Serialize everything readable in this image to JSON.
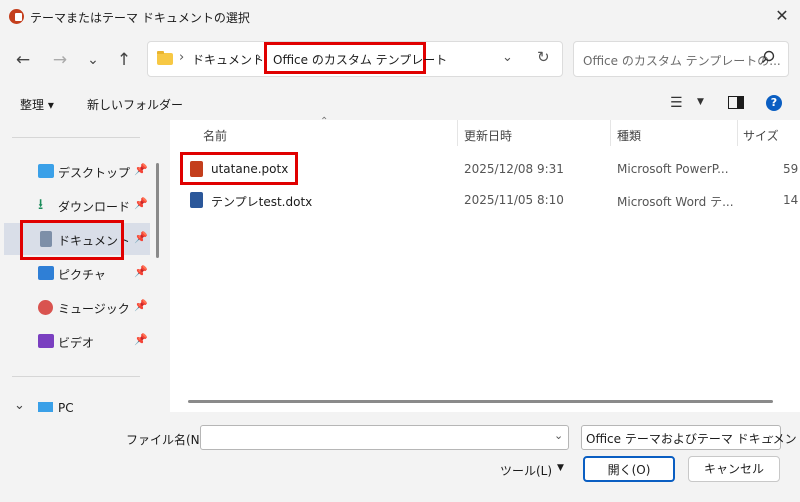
{
  "window": {
    "title": "テーマまたはテーマ ドキュメントの選択",
    "close": "✕"
  },
  "nav": {
    "back": "←",
    "forward": "→",
    "recent": "⌄",
    "up": "↑",
    "breadcrumb": [
      "ドキュメント",
      "Office のカスタム テンプレート"
    ],
    "sep": "›",
    "addr_chevron": "⌄",
    "refresh": "↻",
    "search_placeholder": "Office のカスタム テンプレートの..."
  },
  "toolbar": {
    "organize": "整理 ▾",
    "new_folder": "新しいフォルダー",
    "view_icon": "☰",
    "view_drop": "▼",
    "help": "?"
  },
  "sidebar": {
    "items": [
      {
        "label": "デスクトップ",
        "icon": "desktop-icon",
        "color": "#3aa0e8",
        "pinned": true
      },
      {
        "label": "ダウンロード",
        "icon": "download-icon",
        "color": "#1a8c5a",
        "pinned": true
      },
      {
        "label": "ドキュメント",
        "icon": "documents-icon",
        "color": "#7d8fa8",
        "pinned": true,
        "selected": true
      },
      {
        "label": "ピクチャ",
        "icon": "pictures-icon",
        "color": "#2f7fd6",
        "pinned": true
      },
      {
        "label": "ミュージック",
        "icon": "music-icon",
        "color": "#d9534f",
        "pinned": true
      },
      {
        "label": "ビデオ",
        "icon": "video-icon",
        "color": "#7a3fc0",
        "pinned": true
      }
    ],
    "pin": "📌",
    "pc_chevron": "⌄",
    "pc_label": "PC"
  },
  "columns": {
    "name": "名前",
    "modified": "更新日時",
    "type": "種類",
    "size": "サイズ",
    "sort": "⌃"
  },
  "files": [
    {
      "name": "utatane.potx",
      "modified": "2025/12/08 9:31",
      "type": "Microsoft PowerP...",
      "size": "59",
      "icon": "powerpoint-template-icon",
      "color": "#c43e1c"
    },
    {
      "name": "テンプレtest.dotx",
      "modified": "2025/11/05 8:10",
      "type": "Microsoft Word テ...",
      "size": "14",
      "icon": "word-template-icon",
      "color": "#2b579a"
    }
  ],
  "bottom": {
    "filename_label": "ファイル名(N):",
    "filename_value": "",
    "filename_chevron": "⌄",
    "filetype": "Office テーマおよびテーマ ドキュメント",
    "filetype_chevron": "⌄",
    "tools": "ツール(L)",
    "tools_drop": "▼",
    "open": "開く(O)",
    "cancel": "キャンセル"
  },
  "colors": {
    "accent": "#0a5ec2",
    "highlight": "#e00000"
  }
}
